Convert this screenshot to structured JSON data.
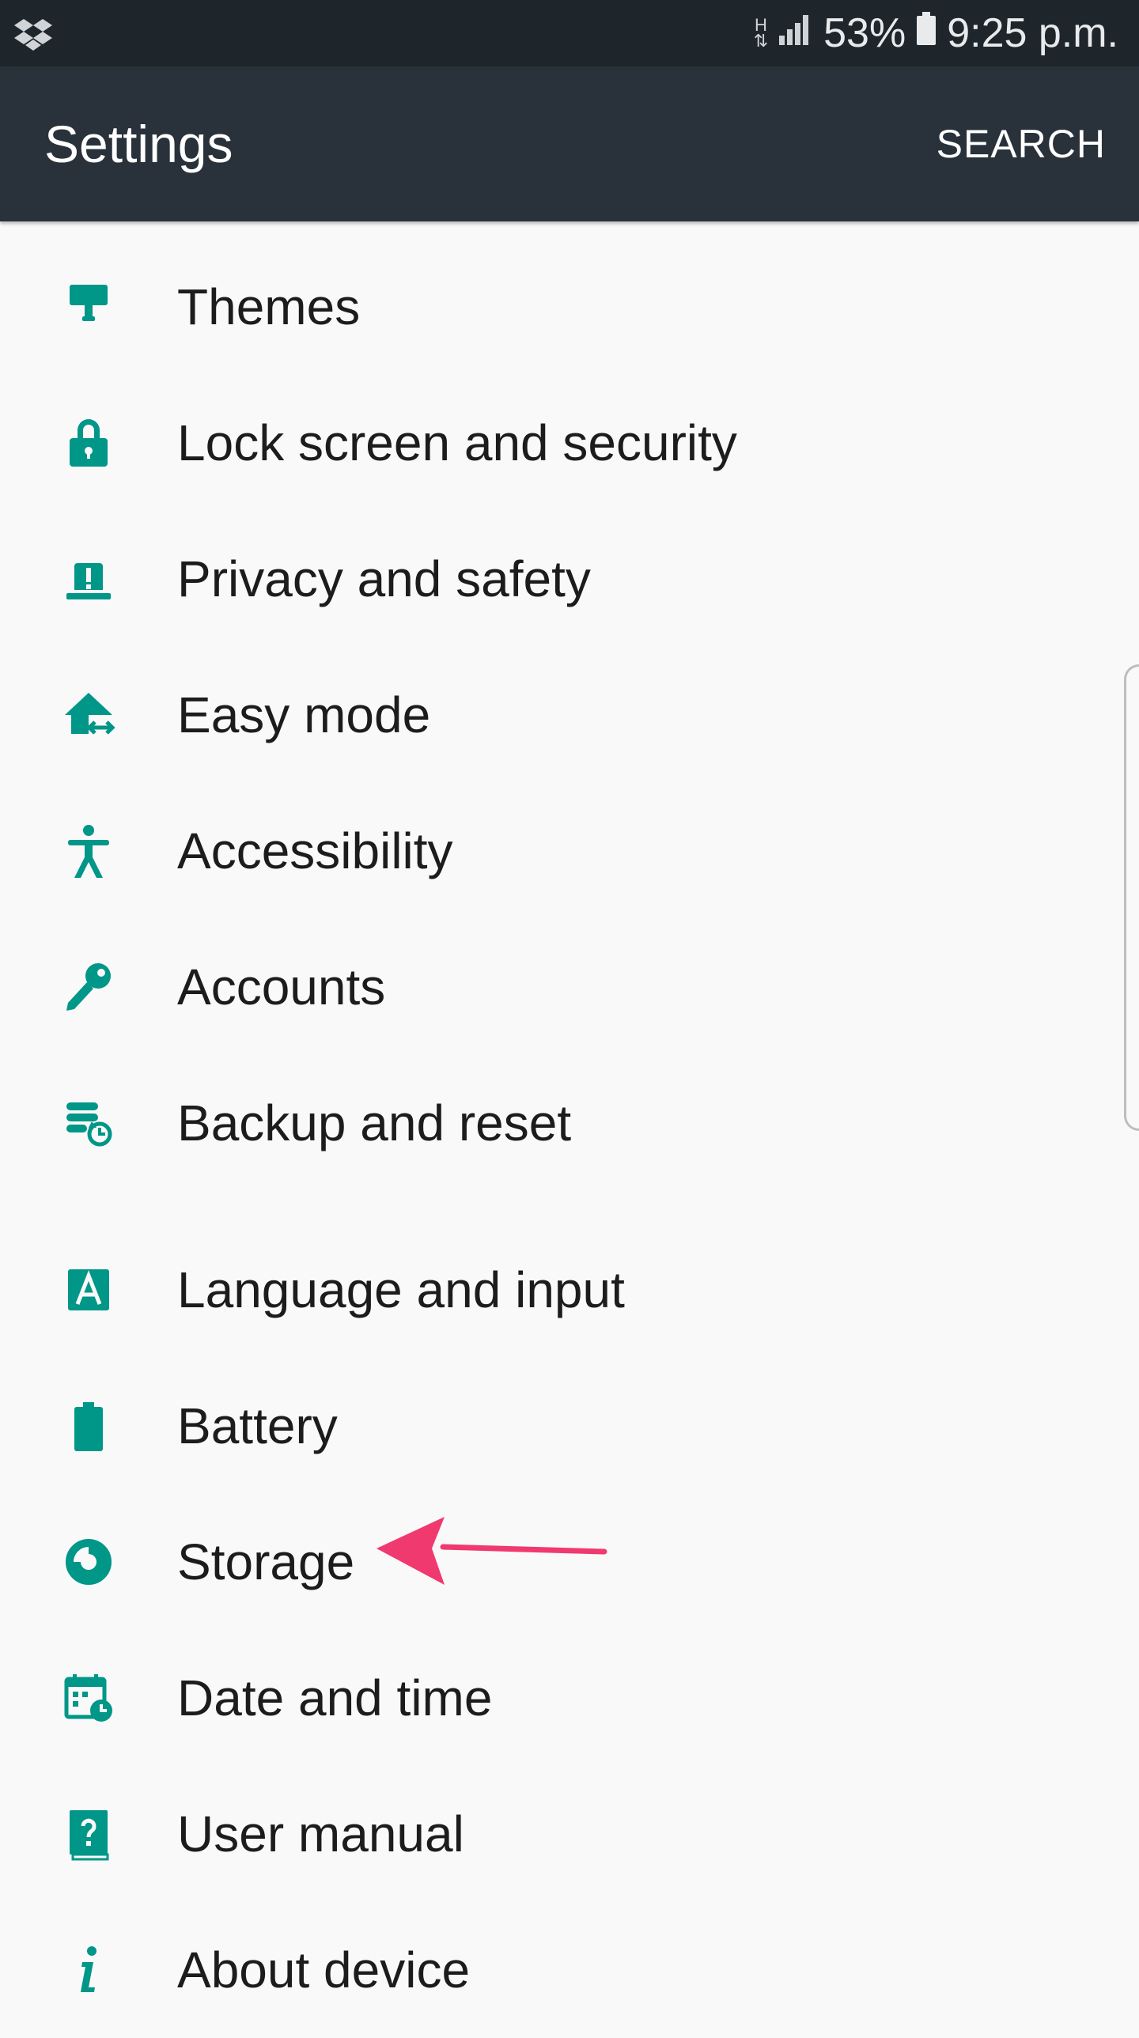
{
  "status_bar": {
    "network": "H",
    "battery_percent": "53%",
    "time": "9:25 p.m.",
    "icons": [
      "dropbox-icon",
      "data-arrows-icon",
      "signal-icon",
      "battery-icon"
    ]
  },
  "app_bar": {
    "title": "Settings",
    "search_label": "SEARCH",
    "background": "#29323a"
  },
  "accent_color": "#009688",
  "annotation_arrow_color": "#f0396f",
  "settings": [
    {
      "label": "Themes",
      "icon": "paint-roller-icon"
    },
    {
      "label": "Lock screen and security",
      "icon": "lock-icon"
    },
    {
      "label": "Privacy and safety",
      "icon": "alert-siren-icon"
    },
    {
      "label": "Easy mode",
      "icon": "easy-mode-house-icon"
    },
    {
      "label": "Accessibility",
      "icon": "accessibility-person-icon"
    },
    {
      "label": "Accounts",
      "icon": "key-icon"
    },
    {
      "label": "Backup and reset",
      "icon": "backup-database-icon"
    },
    {
      "label": "Language and input",
      "icon": "language-a-icon"
    },
    {
      "label": "Battery",
      "icon": "battery-icon"
    },
    {
      "label": "Storage",
      "icon": "storage-pie-icon"
    },
    {
      "label": "Date and time",
      "icon": "calendar-clock-icon"
    },
    {
      "label": "User manual",
      "icon": "help-book-icon"
    },
    {
      "label": "About device",
      "icon": "info-icon"
    }
  ]
}
